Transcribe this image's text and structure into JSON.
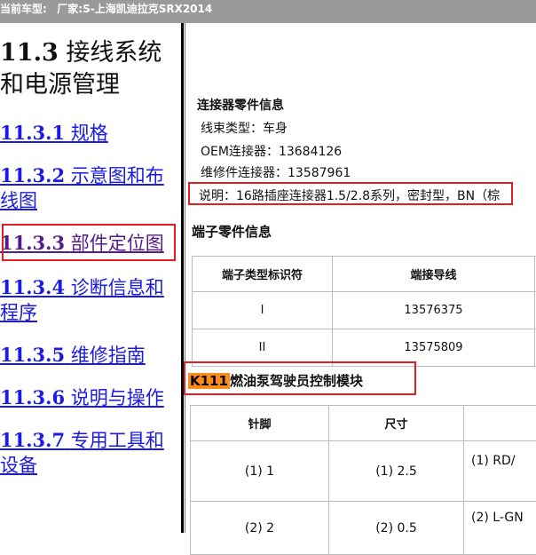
{
  "topbar": {
    "label": "当前车型:",
    "manufacturer": "厂家:S-上海凯迪拉克SRX2014"
  },
  "left": {
    "title_num": "11.3",
    "title_line1": "接线系统",
    "title_line2": "和电源管理",
    "links": [
      {
        "num": "11.3.1",
        "text1": "规格",
        "text2": ""
      },
      {
        "num": "11.3.2",
        "text1": "示意图和布",
        "text2": "线图"
      },
      {
        "num": "11.3.3",
        "text1": "部件定位图",
        "text2": ""
      },
      {
        "num": "11.3.4",
        "text1": "诊断信息和",
        "text2": "程序"
      },
      {
        "num": "11.3.5",
        "text1": "维修指南",
        "text2": ""
      },
      {
        "num": "11.3.6",
        "text1": "说明与操作",
        "text2": ""
      },
      {
        "num": "11.3.7",
        "text1": "专用工具和",
        "text2": "设备"
      }
    ]
  },
  "connector": {
    "title": "连接器零件信息",
    "harness": "线束类型：车身",
    "oem": "OEM连接器：13684126",
    "service": "维修件连接器：13587961",
    "description": "说明：16路插座连接器1.5/2.8系列，密封型，BN（棕"
  },
  "terminal": {
    "title": "端子零件信息",
    "headers": [
      "端子类型标识符",
      "端接导线"
    ],
    "rows": [
      {
        "id": "I",
        "part": "13576375"
      },
      {
        "id": "II",
        "part": "13575809"
      }
    ]
  },
  "module": {
    "code": "K111",
    "name": "燃油泵驾驶员控制模块"
  },
  "pin_table": {
    "headers": [
      "针脚",
      "尺寸",
      ""
    ],
    "rows": [
      {
        "pin": "(1) 1",
        "size": "(1) 2.5",
        "wire": "(1) RD/"
      },
      {
        "pin": "(2) 2",
        "size": "(2) 0.5",
        "wire": "(2) L-GN"
      }
    ]
  },
  "colors": {
    "link": "#1a1ae6",
    "visited": "#551a8b",
    "highlight": "#e02020",
    "tag": "#ff8c1a"
  }
}
